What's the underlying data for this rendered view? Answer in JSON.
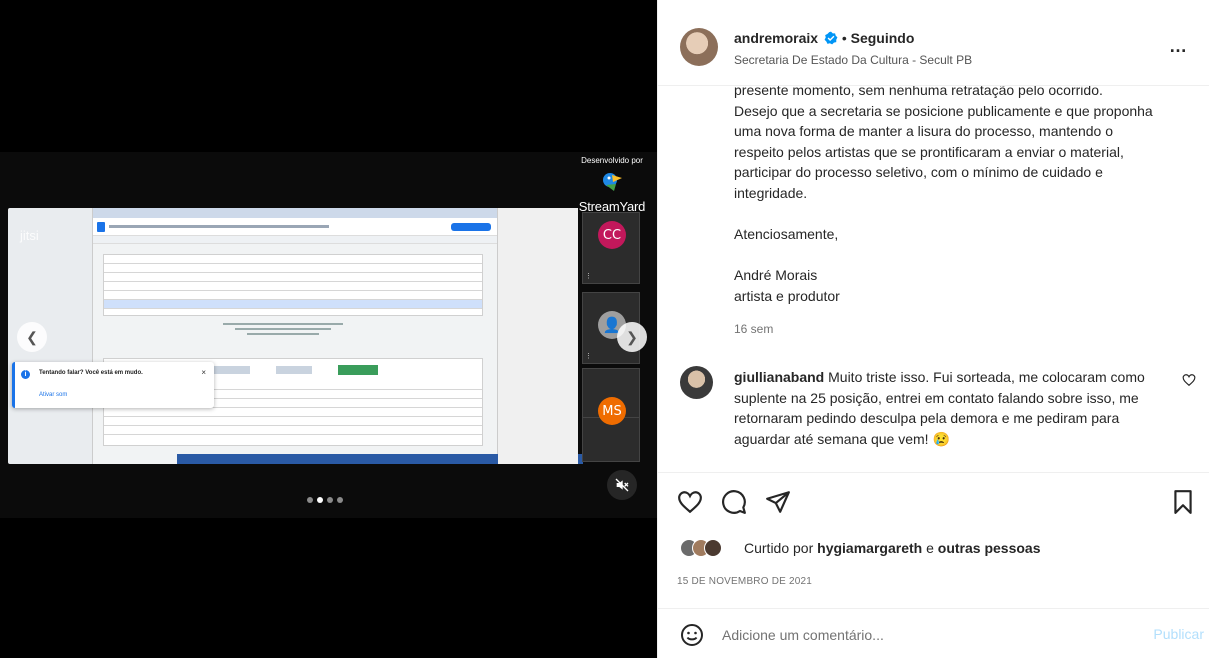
{
  "media": {
    "jitsi_label": "jitsi",
    "brand_developed_by": "Desenvolvido por",
    "brand_name": "StreamYard",
    "toast_title": "Tentando falar? Você está em mudo.",
    "toast_action": "Ativar som",
    "toast_close": "×",
    "participants": [
      {
        "initials": "CC",
        "color": "#c2185b"
      },
      {
        "initials": "",
        "color": "#9e9e9e"
      },
      {
        "initials": "",
        "color": "#777777"
      },
      {
        "initials": "MS",
        "color": "#ef6c00"
      }
    ],
    "carousel_dots": 4,
    "active_dot": 2,
    "icons": {
      "prev": "chevron-left-icon",
      "next": "chevron-right-icon",
      "mute": "volume-muted-icon"
    }
  },
  "post": {
    "username": "andremoraix",
    "separator": "•",
    "follow_status": "Seguindo",
    "location": "Secretaria De Estado Da Cultura - Secult PB",
    "more": "…",
    "caption_lines": [
      "presente momento, sem nenhuma retratação pelo ocorrido.",
      "Desejo que a secretaria se posicione publicamente e que proponha",
      "uma nova forma de manter a lisura do processo, mantendo o",
      "respeito pelos artistas que se prontificaram a enviar o material,",
      "participar do processo seletivo, com o mínimo de cuidado e",
      "integridade."
    ],
    "closing": "Atenciosamente,",
    "signature_name": "André Morais",
    "signature_role": "artista e produtor",
    "time_ago": "16 sem",
    "comment": {
      "username": "giullianaband",
      "text": "Muito triste isso. Fui sorteada, me colocaram como suplente na 25 posição, entrei em contato falando sobre isso, me retornaram pedindo desculpa pela demora e me pediram para aguardar até semana que vem! 😢"
    },
    "likes": {
      "prefix": "Curtido por",
      "user": "hygiamargareth",
      "conjunction": "e",
      "others": "outras pessoas"
    },
    "date": "15 DE NOVEMBRO DE 2021",
    "add_comment_placeholder": "Adicione um comentário...",
    "publish_label": "Publicar",
    "colors": {
      "verified": "#0095f6",
      "publish": "#b2dffc"
    }
  }
}
